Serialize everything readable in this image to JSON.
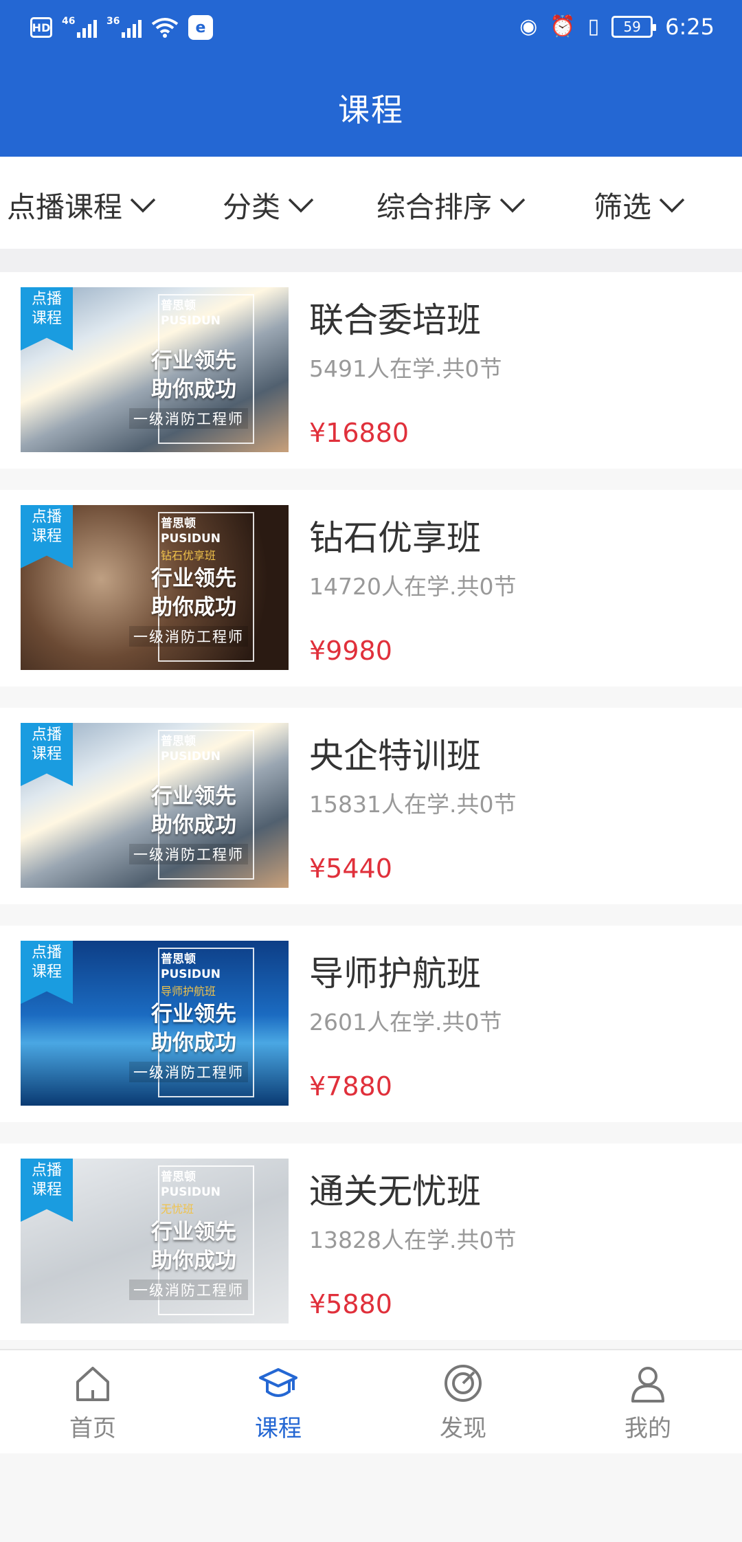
{
  "status_bar": {
    "hd": "HD",
    "net1": "46",
    "net2": "36",
    "battery": "59",
    "time": "6:25"
  },
  "header": {
    "title": "课程"
  },
  "filters": [
    {
      "label": "点播课程"
    },
    {
      "label": "分类"
    },
    {
      "label": "综合排序"
    },
    {
      "label": "筛选"
    }
  ],
  "courses": [
    {
      "title": "联合委培班",
      "meta": "5491人在学.共0节",
      "price": "¥16880",
      "badge": "点播课程",
      "img": {
        "brand": "普思顿",
        "brand_en": "PUSIDUN",
        "subtitle": "",
        "slogan1": "行业领先",
        "slogan2": "助你成功",
        "cert": "一级消防工程师"
      }
    },
    {
      "title": "钻石优享班",
      "meta": "14720人在学.共0节",
      "price": "¥9980",
      "badge": "点播课程",
      "img": {
        "brand": "普思顿",
        "brand_en": "PUSIDUN",
        "subtitle": "钻石优享班",
        "slogan1": "行业领先",
        "slogan2": "助你成功",
        "cert": "一级消防工程师"
      }
    },
    {
      "title": "央企特训班",
      "meta": "15831人在学.共0节",
      "price": "¥5440",
      "badge": "点播课程",
      "img": {
        "brand": "普思顿",
        "brand_en": "PUSIDUN",
        "subtitle": "",
        "slogan1": "行业领先",
        "slogan2": "助你成功",
        "cert": "一级消防工程师"
      }
    },
    {
      "title": "导师护航班",
      "meta": "2601人在学.共0节",
      "price": "¥7880",
      "badge": "点播课程",
      "img": {
        "brand": "普思顿",
        "brand_en": "PUSIDUN",
        "subtitle": "导师护航班",
        "slogan1": "行业领先",
        "slogan2": "助你成功",
        "cert": "一级消防工程师"
      }
    },
    {
      "title": "通关无忧班",
      "meta": "13828人在学.共0节",
      "price": "¥5880",
      "badge": "点播课程",
      "img": {
        "brand": "普思顿",
        "brand_en": "PUSIDUN",
        "subtitle": "无忧班",
        "slogan1": "行业领先",
        "slogan2": "助你成功",
        "cert": "一级消防工程师"
      }
    }
  ],
  "tabbar": [
    {
      "label": "首页",
      "icon": "home-icon"
    },
    {
      "label": "课程",
      "icon": "graduation-cap-icon"
    },
    {
      "label": "发现",
      "icon": "compass-icon"
    },
    {
      "label": "我的",
      "icon": "user-icon"
    }
  ],
  "colors": {
    "primary": "#2467d3",
    "price": "#e0303b",
    "badge": "#1a9ce0"
  }
}
